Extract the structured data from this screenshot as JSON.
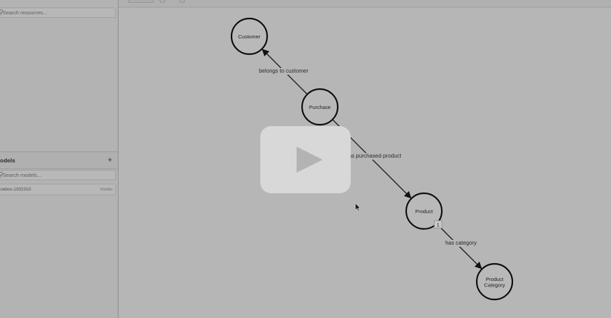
{
  "resources": {
    "search_placeholder": "Search resources..."
  },
  "models": {
    "title": "odels",
    "add_label": "+",
    "search_placeholder": "Search models...",
    "items": [
      {
        "name": "icebox-1032310",
        "type": "model"
      }
    ]
  },
  "graph": {
    "nodes": [
      {
        "id": "customer",
        "lines": [
          "Customer"
        ]
      },
      {
        "id": "purchase",
        "lines": [
          "Purchase"
        ]
      },
      {
        "id": "product",
        "lines": [
          "Product"
        ]
      },
      {
        "id": "product-category",
        "lines": [
          "Product",
          "Category"
        ]
      }
    ],
    "edges": [
      {
        "from": "purchase",
        "to": "customer",
        "label": "belongs to customer"
      },
      {
        "from": "purchase",
        "to": "product",
        "label": "has purchased product"
      },
      {
        "from": "product",
        "to": "product-category",
        "label": "has category"
      }
    ],
    "badge": "1"
  },
  "icons": {
    "search": "search-icon",
    "play": "play-icon",
    "cursor": "cursor-icon"
  }
}
